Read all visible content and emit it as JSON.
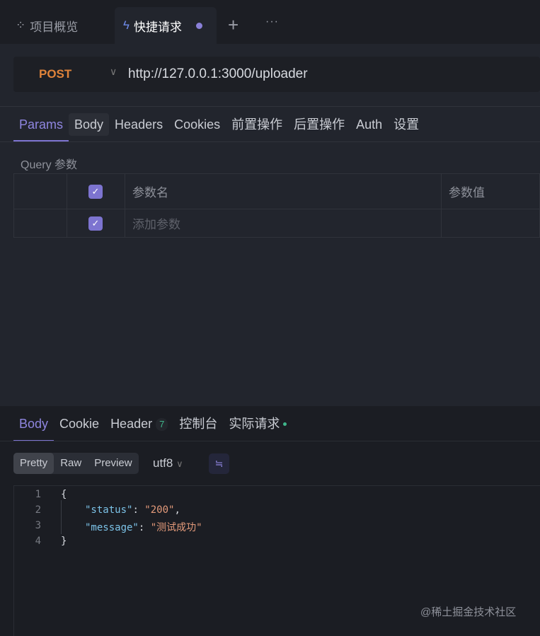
{
  "tabs": [
    {
      "label": "项目概览",
      "icon": "grid-icon"
    },
    {
      "label": "快捷请求",
      "icon": "lightning-icon"
    }
  ],
  "add_tab": "+",
  "more": "···",
  "request": {
    "method": "POST",
    "url": "http://127.0.0.1:3000/uploader"
  },
  "request_tabs": [
    "Params",
    "Body",
    "Headers",
    "Cookies",
    "前置操作",
    "后置操作",
    "Auth",
    "设置"
  ],
  "query": {
    "label": "Query 参数",
    "header": {
      "name": "参数名",
      "value": "参数值"
    },
    "row_placeholder": "添加参数"
  },
  "response_tabs": {
    "body": "Body",
    "cookie": "Cookie",
    "header": "Header",
    "header_count": "7",
    "console": "控制台",
    "actual": "实际请求"
  },
  "view_modes": [
    "Pretty",
    "Raw",
    "Preview"
  ],
  "encoding": "utf8",
  "code": {
    "lines": [
      "1",
      "2",
      "3",
      "4"
    ],
    "open": "{",
    "status_key": "\"status\"",
    "status_val": "\"200\"",
    "message_key": "\"message\"",
    "message_val": "\"测试成功\"",
    "close": "}"
  },
  "watermark": "@稀土掘金技术社区",
  "colors": {
    "accent": "#7d74d0",
    "method": "#e0833a",
    "success": "#3fb68b"
  }
}
